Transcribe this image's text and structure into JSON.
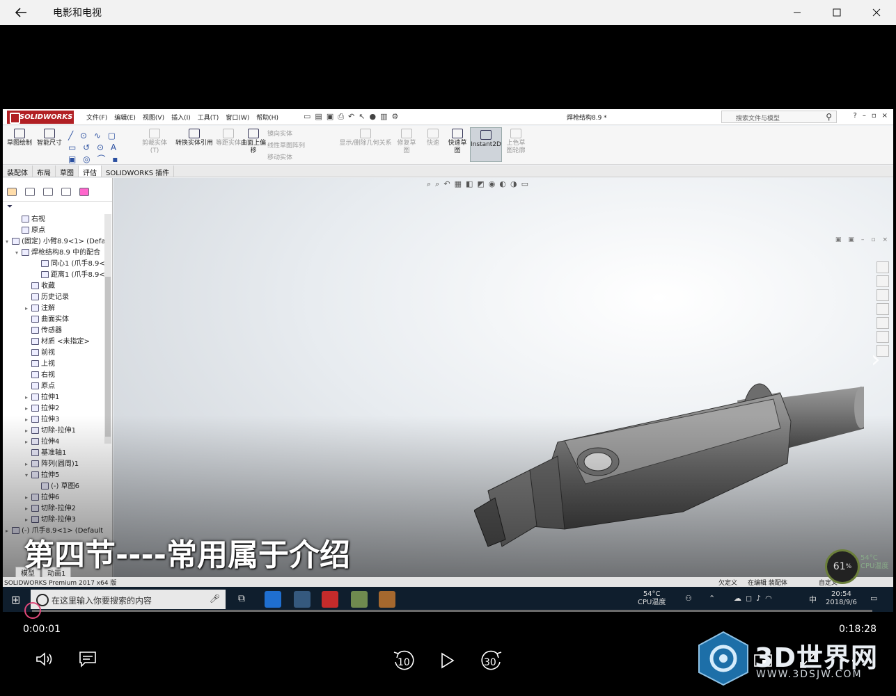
{
  "window": {
    "title": "电影和电视"
  },
  "solidworks": {
    "logo": "SOLIDWORKS",
    "menus": [
      "文件(F)",
      "编辑(E)",
      "视图(V)",
      "插入(I)",
      "工具(T)",
      "窗口(W)",
      "帮助(H)"
    ],
    "doc_title": "焊枪结构8.9 *",
    "search_placeholder": "搜索文件与模型",
    "ribbon": {
      "sketch": "草图绘制",
      "smart_dim": "智能尺寸",
      "trim": "剪裁实体(T)",
      "convert": "转换实体引用",
      "offset": "等距实体",
      "offset_surface": "曲面上偏移",
      "mirror": "镜向实体",
      "linear_pattern": "线性草图阵列",
      "move": "移动实体",
      "display_relations": "显示/删除几何关系",
      "repair": "修复草图",
      "quick_snap": "快速",
      "rapid_sketch": "快速草图",
      "instant2d": "Instant2D",
      "shaded": "上色草图轮廓"
    },
    "tabs": [
      "装配体",
      "布局",
      "草图",
      "评估",
      "SOLIDWORKS 插件"
    ],
    "active_tab": "评估",
    "tree": [
      {
        "label": "右视",
        "indent": 1,
        "icon": "plane-icon"
      },
      {
        "label": "原点",
        "indent": 1,
        "icon": "origin-icon"
      },
      {
        "label": "(固定) 小臂8.9<1> (Defa",
        "indent": 0,
        "icon": "part-icon",
        "exp": "▾"
      },
      {
        "label": "焊枪结构8.9 中的配合",
        "indent": 1,
        "icon": "mate-icon",
        "exp": "▾"
      },
      {
        "label": "同心1 (爪手8.9<1:",
        "indent": 3,
        "icon": "concentric-icon"
      },
      {
        "label": "距离1 (爪手8.9<1:",
        "indent": 3,
        "icon": "distance-icon"
      },
      {
        "label": "收藏",
        "indent": 2,
        "icon": "folder-icon"
      },
      {
        "label": "历史记录",
        "indent": 2,
        "icon": "history-icon"
      },
      {
        "label": "注解",
        "indent": 2,
        "icon": "annotation-icon",
        "exp": "▸"
      },
      {
        "label": "曲面实体",
        "indent": 2,
        "icon": "surface-icon"
      },
      {
        "label": "传感器",
        "indent": 2,
        "icon": "sensor-icon"
      },
      {
        "label": "材质 <未指定>",
        "indent": 2,
        "icon": "material-icon"
      },
      {
        "label": "前视",
        "indent": 2,
        "icon": "plane-icon"
      },
      {
        "label": "上视",
        "indent": 2,
        "icon": "plane-icon"
      },
      {
        "label": "右视",
        "indent": 2,
        "icon": "plane-icon"
      },
      {
        "label": "原点",
        "indent": 2,
        "icon": "origin-icon"
      },
      {
        "label": "拉伸1",
        "indent": 2,
        "icon": "extrude-icon",
        "exp": "▸"
      },
      {
        "label": "拉伸2",
        "indent": 2,
        "icon": "extrude-icon",
        "exp": "▸"
      },
      {
        "label": "拉伸3",
        "indent": 2,
        "icon": "extrude-icon",
        "exp": "▸"
      },
      {
        "label": "切除-拉伸1",
        "indent": 2,
        "icon": "cut-icon",
        "exp": "▸"
      },
      {
        "label": "拉伸4",
        "indent": 2,
        "icon": "extrude-icon",
        "exp": "▸"
      },
      {
        "label": "基准轴1",
        "indent": 2,
        "icon": "axis-icon"
      },
      {
        "label": "阵列(圆周)1",
        "indent": 2,
        "icon": "pattern-icon",
        "exp": "▸"
      },
      {
        "label": "拉伸5",
        "indent": 2,
        "icon": "extrude-icon",
        "exp": "▾"
      },
      {
        "label": "(-) 草图6",
        "indent": 3,
        "icon": "sketch-icon"
      },
      {
        "label": "拉伸6",
        "indent": 2,
        "icon": "extrude-icon",
        "exp": "▸"
      },
      {
        "label": "切除-拉伸2",
        "indent": 2,
        "icon": "cut-icon",
        "exp": "▸"
      },
      {
        "label": "切除-拉伸3",
        "indent": 2,
        "icon": "cut-icon",
        "exp": "▸"
      },
      {
        "label": "(-) 爪手8.9<1> (Default",
        "indent": 0,
        "icon": "part-icon",
        "exp": "▸"
      }
    ],
    "sheet_tabs": [
      "模型",
      "动画1"
    ],
    "status_left": "SOLIDWORKS Premium 2017 x64 版",
    "status_right": [
      "欠定义",
      "在编辑 装配体",
      "自定义"
    ]
  },
  "subtitle": "第四节----常用属于介绍",
  "taskbar": {
    "search_placeholder": "在这里输入你要搜索的内容",
    "temp": "54°C",
    "temp_label": "CPU温度",
    "ime": "中",
    "time": "20:54",
    "date": "2018/9/6"
  },
  "cpu_gauge": {
    "percent": "61",
    "unit": "%",
    "temp": "54°C",
    "label": "CPU温度"
  },
  "player": {
    "current_time": "0:00:01",
    "total_time": "0:18:28",
    "progress": 0.001,
    "rewind_label": "10",
    "forward_label": "30"
  },
  "watermark": {
    "brand": "3D世界网",
    "url": "WWW.3DSJW.COM"
  }
}
